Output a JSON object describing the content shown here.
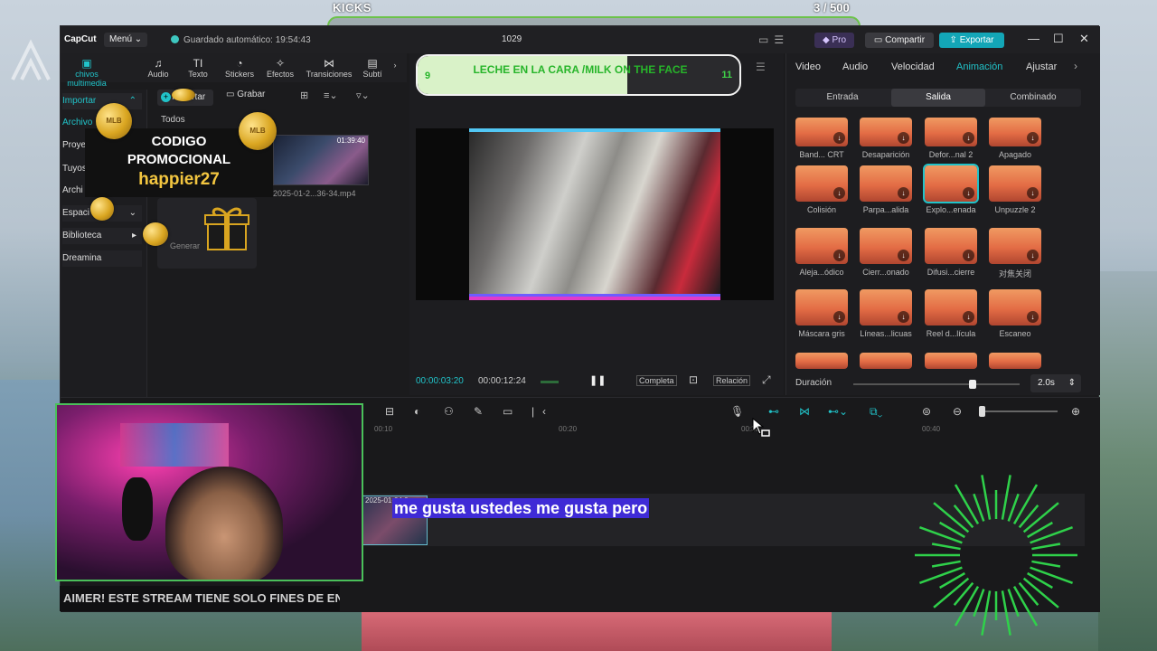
{
  "overlay": {
    "kicks_label": "KICKS",
    "kicks_count": "3 / 500",
    "promo_line1": "CODIGO",
    "promo_line2": "PROMOCIONAL",
    "promo_code": "happier27",
    "vote_left": "9",
    "vote_text": "LECHE EN LA CARA /MILK ON THE FACE",
    "vote_right": "11",
    "subtitle": "me gusta ustedes me gusta pero",
    "ticker": "AIMER! ESTE STREAM TIENE SOLO FINES DE EN"
  },
  "titlebar": {
    "brand": "CapCut",
    "menu": "Menú",
    "autosave": "Guardado automático: 19:54:43",
    "project": "1029",
    "pro": "Pro",
    "share": "Compartir",
    "export": "Exportar"
  },
  "toolbar": {
    "items": [
      {
        "label": "chivos multimedia",
        "icon": "media-icon"
      },
      {
        "label": "Audio",
        "icon": "audio-icon"
      },
      {
        "label": "Texto",
        "icon": "text-icon"
      },
      {
        "label": "Stickers",
        "icon": "sticker-icon"
      },
      {
        "label": "Efectos",
        "icon": "effects-icon"
      },
      {
        "label": "Transiciones",
        "icon": "transitions-icon"
      },
      {
        "label": "Subtí",
        "icon": "subtitles-icon"
      }
    ]
  },
  "sidebar": {
    "items": [
      "Importar",
      "Archivo",
      "Proye",
      "Tuyos",
      "Archi",
      "Espaci",
      "Biblioteca",
      "Dreamina"
    ]
  },
  "media": {
    "import": "Importar",
    "record": "Grabar",
    "all": "Todos",
    "clip_duration": "01:39:40",
    "clip_name": "2025-01-2...36-34.mp4",
    "generate": "Generar"
  },
  "preview": {
    "time_current": "00:00:03:20",
    "time_total": "00:00:12:24",
    "full": "Completa",
    "ratio": "Relación"
  },
  "inspector": {
    "tabs": [
      "Video",
      "Audio",
      "Velocidad",
      "Animación",
      "Ajustar"
    ],
    "active_tab": "Animación",
    "sub_tabs": [
      "Entrada",
      "Salida",
      "Combinado"
    ],
    "active_sub": "Salida",
    "effects": [
      "Band... CRT",
      "Desaparición",
      "Defor...nal 2",
      "Apagado",
      "Colisión",
      "Parpa...alida",
      "Explo...enada",
      "Unpuzzle 2",
      "Aleja...ódico",
      "Cierr...onado",
      "Difusi...cierre",
      "对焦关闭",
      "Máscara gris",
      "Líneas...licuas",
      "Reel d...lícula",
      "Escaneo"
    ],
    "duration_label": "Duración",
    "duration_value": "2.0s",
    "duration_fraction": 0.72
  },
  "timeline": {
    "ticks": [
      "00:10",
      "00:20",
      "00:30",
      "00:40"
    ],
    "clip_name": "2025-01-04 0"
  },
  "colors": {
    "accent": "#21c3c9",
    "export": "#13a6b7",
    "subtitle_bg": "#3f2bd6",
    "vote_text": "#27b52a",
    "promo_code": "#f3c640"
  }
}
